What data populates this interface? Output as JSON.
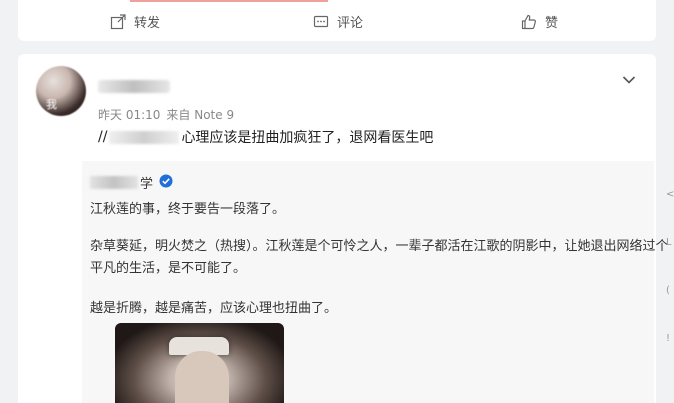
{
  "actions": {
    "share_label": "转发",
    "comment_label": "评论",
    "like_label": "赞"
  },
  "post": {
    "avatar_text": "我",
    "time": "昨天 01:10",
    "source": "来自 Note 9",
    "text_prefix": "//",
    "text_body": "心理应该是扭曲加疯狂了，退网看医生吧"
  },
  "repost": {
    "author_suffix": "学",
    "line1": "江秋莲的事，终于要告一段落了。",
    "line2": "杂草葵延，明火焚之（热搜）。江秋莲是个可怜之人，一辈子都活在江歌的阴影中，让她退出网络过个",
    "line3": "平凡的生活，是不可能了。",
    "line4": "越是折腾，越是痛苦，应该心理也扭曲了。"
  },
  "side_icons": [
    "<",
    "L",
    "(",
    "!"
  ],
  "colors": {
    "verified": "#1f6fd6",
    "accent_line": "#f2a19a"
  }
}
